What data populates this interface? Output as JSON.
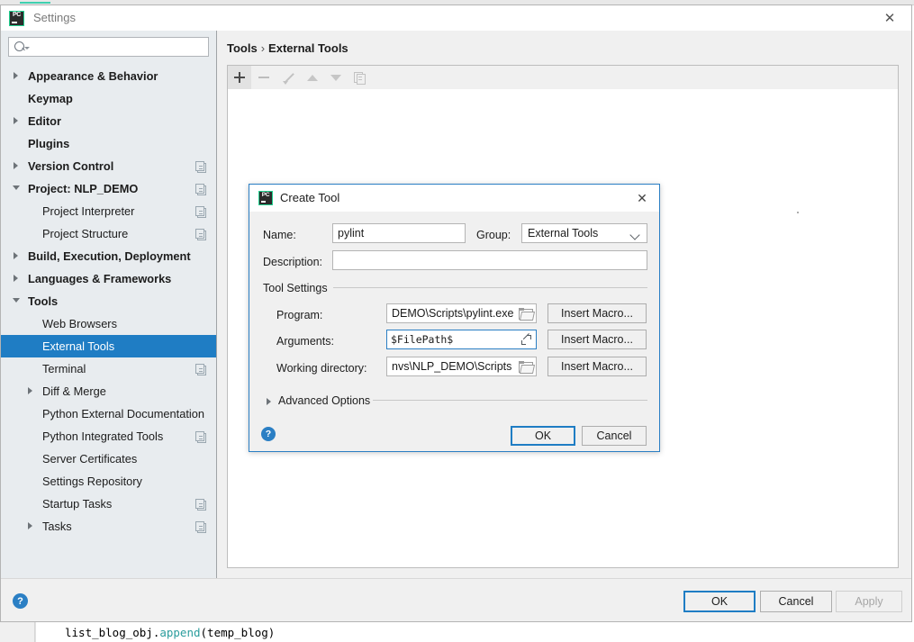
{
  "background": {
    "code_line_prefix": "list_blog_obj.",
    "code_line_fn": "append",
    "code_line_args": "(temp_blog)"
  },
  "window": {
    "title": "Settings",
    "logo": "pycharm-icon",
    "close": "✕"
  },
  "search": {
    "value": "",
    "placeholder": ""
  },
  "sidebar": {
    "items": [
      {
        "label": "Appearance & Behavior",
        "level": 0,
        "arrow": "right",
        "copyable": false,
        "selected": false
      },
      {
        "label": "Keymap",
        "level": 0,
        "arrow": "none",
        "copyable": false,
        "selected": false
      },
      {
        "label": "Editor",
        "level": 0,
        "arrow": "right",
        "copyable": false,
        "selected": false
      },
      {
        "label": "Plugins",
        "level": 0,
        "arrow": "none",
        "copyable": false,
        "selected": false
      },
      {
        "label": "Version Control",
        "level": 0,
        "arrow": "right",
        "copyable": true,
        "selected": false
      },
      {
        "label": "Project: NLP_DEMO",
        "level": 0,
        "arrow": "down",
        "copyable": true,
        "selected": false
      },
      {
        "label": "Project Interpreter",
        "level": 1,
        "arrow": "none",
        "copyable": true,
        "selected": false
      },
      {
        "label": "Project Structure",
        "level": 1,
        "arrow": "none",
        "copyable": true,
        "selected": false
      },
      {
        "label": "Build, Execution, Deployment",
        "level": 0,
        "arrow": "right",
        "copyable": false,
        "selected": false
      },
      {
        "label": "Languages & Frameworks",
        "level": 0,
        "arrow": "right",
        "copyable": false,
        "selected": false
      },
      {
        "label": "Tools",
        "level": 0,
        "arrow": "down",
        "copyable": false,
        "selected": false
      },
      {
        "label": "Web Browsers",
        "level": 1,
        "arrow": "none",
        "copyable": false,
        "selected": false
      },
      {
        "label": "External Tools",
        "level": 1,
        "arrow": "none",
        "copyable": false,
        "selected": true
      },
      {
        "label": "Terminal",
        "level": 1,
        "arrow": "none",
        "copyable": true,
        "selected": false
      },
      {
        "label": "Diff & Merge",
        "level": 1,
        "arrow": "right",
        "copyable": false,
        "selected": false
      },
      {
        "label": "Python External Documentation",
        "level": 1,
        "arrow": "none",
        "copyable": false,
        "selected": false
      },
      {
        "label": "Python Integrated Tools",
        "level": 1,
        "arrow": "none",
        "copyable": true,
        "selected": false
      },
      {
        "label": "Server Certificates",
        "level": 1,
        "arrow": "none",
        "copyable": false,
        "selected": false
      },
      {
        "label": "Settings Repository",
        "level": 1,
        "arrow": "none",
        "copyable": false,
        "selected": false
      },
      {
        "label": "Startup Tasks",
        "level": 1,
        "arrow": "none",
        "copyable": true,
        "selected": false
      },
      {
        "label": "Tasks",
        "level": 1,
        "arrow": "right",
        "copyable": true,
        "selected": false
      }
    ]
  },
  "main": {
    "breadcrumb": {
      "parent": "Tools",
      "separator": "›",
      "current": "External Tools"
    },
    "toolbar": [
      {
        "name": "add-button",
        "icon": "plus-icon",
        "enabled": true
      },
      {
        "name": "remove-button",
        "icon": "minus-icon",
        "enabled": false
      },
      {
        "name": "edit-button",
        "icon": "pencil-icon",
        "enabled": false
      },
      {
        "name": "move-up-button",
        "icon": "arrow-up-icon",
        "enabled": false
      },
      {
        "name": "move-down-button",
        "icon": "arrow-down-icon",
        "enabled": false
      },
      {
        "name": "copy-button",
        "icon": "copy-icon",
        "enabled": false
      }
    ]
  },
  "footer": {
    "help_glyph": "?",
    "ok": "OK",
    "cancel": "Cancel",
    "apply": "Apply"
  },
  "dialog": {
    "title": "Create Tool",
    "logo": "pycharm-icon",
    "close": "✕",
    "name_label": "Name:",
    "name_value": "pylint",
    "group_label": "Group:",
    "group_value": "External Tools",
    "group_options": [
      "External Tools"
    ],
    "description_label": "Description:",
    "description_value": "",
    "tool_settings_label": "Tool Settings",
    "program_label": "Program:",
    "program_value": "DEMO\\Scripts\\pylint.exe",
    "arguments_label": "Arguments:",
    "arguments_value": "$FilePath$",
    "working_directory_label": "Working directory:",
    "working_directory_value": "nvs\\NLP_DEMO\\Scripts",
    "insert_macro_label": "Insert Macro...",
    "advanced_options_label": "Advanced Options",
    "help_glyph": "?",
    "ok": "OK",
    "cancel": "Cancel"
  },
  "colors": {
    "accent": "#1f7dc4",
    "selection": "#1f7dc4",
    "sidebar_bg": "#e8ecef",
    "window_bg": "#f0f0f0",
    "logo_green": "#21d08f"
  }
}
